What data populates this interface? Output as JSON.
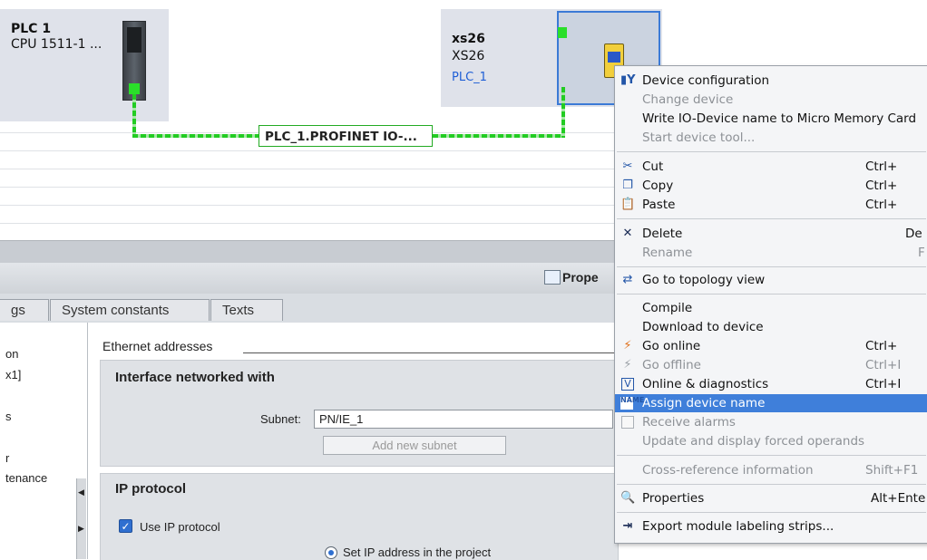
{
  "network": {
    "plc": {
      "title": "PLC 1",
      "subtitle": "CPU 1511-1 ..."
    },
    "io_device": {
      "title": "xs26",
      "subtitle": "XS26",
      "link": "PLC_1"
    },
    "subnet_label": "PLC_1.PROFINET IO-..."
  },
  "inspector": {
    "properties_tab": "Prope",
    "tabs": [
      {
        "label": "gs"
      },
      {
        "label": "System constants"
      },
      {
        "label": "Texts"
      }
    ],
    "nav_items": [
      "on",
      "x1]",
      "s",
      "r",
      "tenance"
    ],
    "section_header": "Ethernet addresses",
    "interface": {
      "title": "Interface networked with",
      "subnet_label": "Subnet:",
      "subnet_value": "PN/IE_1",
      "add_subnet": "Add new subnet"
    },
    "ip": {
      "title": "IP protocol",
      "use_ip_label": "Use IP protocol",
      "use_ip_checked": true,
      "set_ip_label": "Set IP address in the project"
    }
  },
  "context_menu": {
    "items": [
      {
        "label": "Device configuration",
        "shortcut": "",
        "icon": "device-config-icon",
        "disabled": false
      },
      {
        "label": "Change device",
        "shortcut": "",
        "icon": "",
        "disabled": true
      },
      {
        "label": "Write IO-Device name to Micro Memory Card",
        "shortcut": "",
        "icon": "",
        "disabled": false
      },
      {
        "label": "Start device tool...",
        "shortcut": "",
        "icon": "",
        "disabled": true
      },
      {
        "label": "Cut",
        "shortcut": "Ctrl+",
        "icon": "scissors-icon",
        "disabled": false
      },
      {
        "label": "Copy",
        "shortcut": "Ctrl+",
        "icon": "copy-icon",
        "disabled": false
      },
      {
        "label": "Paste",
        "shortcut": "Ctrl+",
        "icon": "paste-icon",
        "disabled": false
      },
      {
        "label": "Delete",
        "shortcut": "De",
        "icon": "delete-icon",
        "disabled": false
      },
      {
        "label": "Rename",
        "shortcut": "F",
        "icon": "",
        "disabled": true
      },
      {
        "label": "Go to topology view",
        "shortcut": "",
        "icon": "topology-icon",
        "disabled": false
      },
      {
        "label": "Compile",
        "shortcut": "",
        "icon": "",
        "disabled": false
      },
      {
        "label": "Download to device",
        "shortcut": "",
        "icon": "",
        "disabled": false
      },
      {
        "label": "Go online",
        "shortcut": "Ctrl+",
        "icon": "go-online-icon",
        "disabled": false
      },
      {
        "label": "Go offline",
        "shortcut": "Ctrl+I",
        "icon": "go-offline-icon",
        "disabled": true
      },
      {
        "label": "Online & diagnostics",
        "shortcut": "Ctrl+I",
        "icon": "diagnostics-icon",
        "disabled": false
      },
      {
        "label": "Assign device name",
        "shortcut": "",
        "icon": "assign-name-icon",
        "disabled": false,
        "highlighted": true
      },
      {
        "label": "Receive alarms",
        "shortcut": "",
        "icon": "checkbox-icon",
        "disabled": true
      },
      {
        "label": "Update and display forced operands",
        "shortcut": "",
        "icon": "",
        "disabled": true
      },
      {
        "label": "Cross-reference information",
        "shortcut": "Shift+F1",
        "icon": "",
        "disabled": true
      },
      {
        "label": "Properties",
        "shortcut": "Alt+Ente",
        "icon": "properties-icon",
        "disabled": false
      },
      {
        "label": "Export module labeling strips...",
        "shortcut": "",
        "icon": "export-icon",
        "disabled": false
      }
    ]
  },
  "colors": {
    "accent": "#3f7fda",
    "network_green": "#22cc22",
    "link_blue": "#1f5fd6"
  }
}
